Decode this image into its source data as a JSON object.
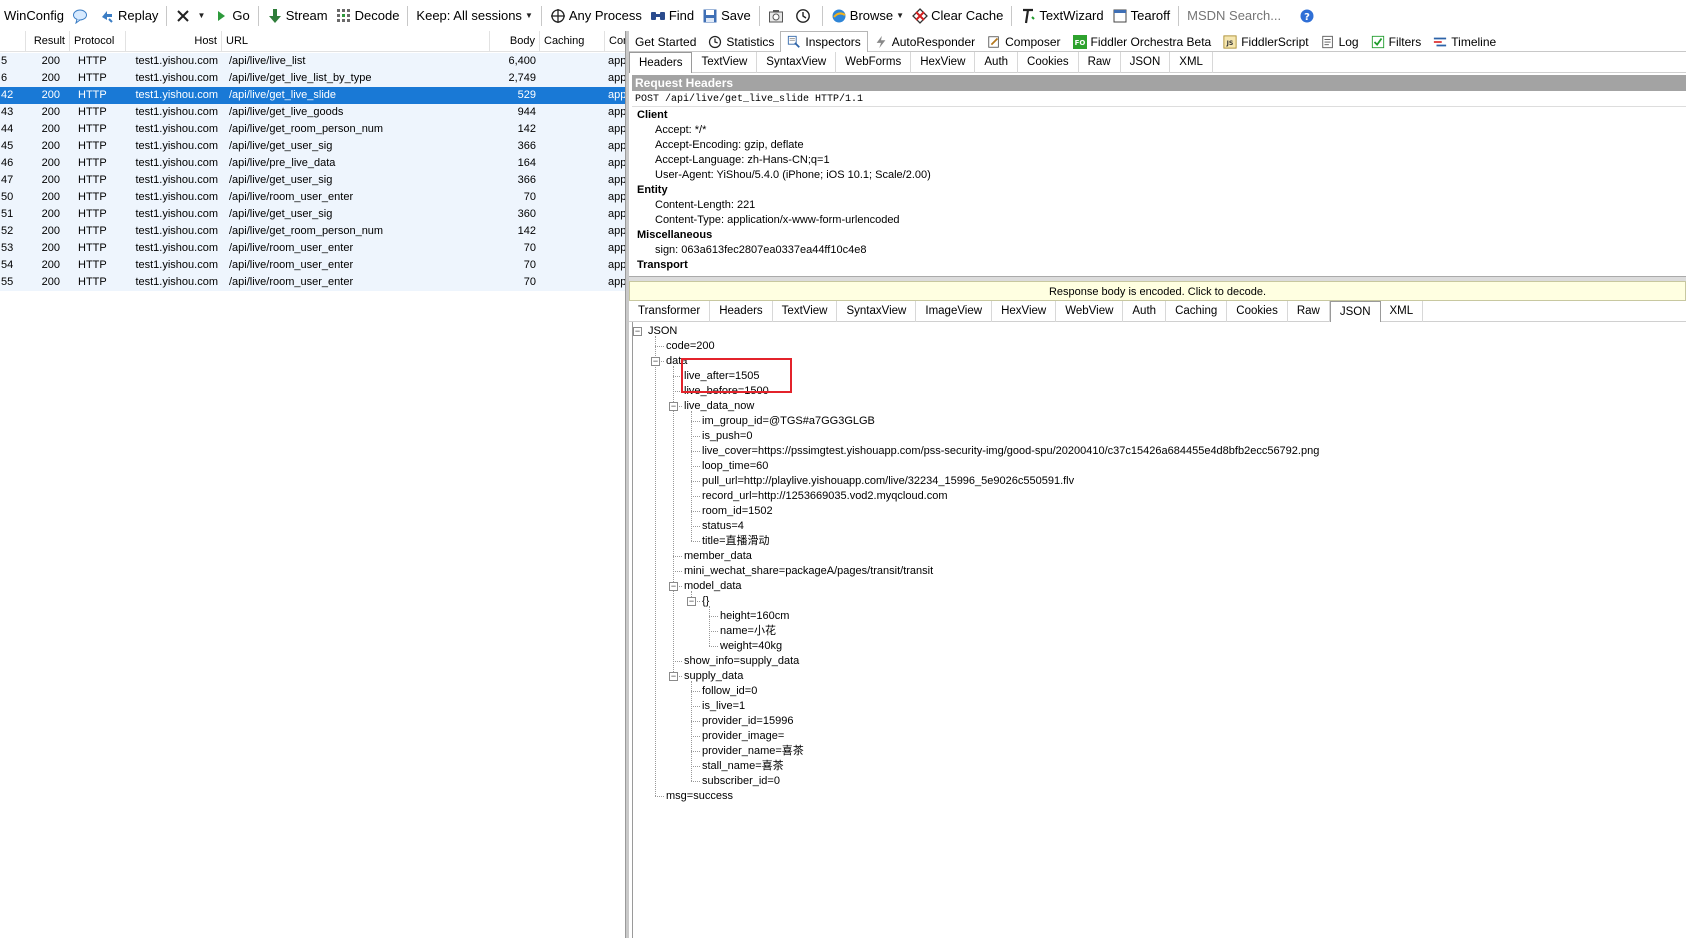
{
  "toolbar": {
    "items": [
      {
        "label": "WinConfig",
        "icon": "winconfig-icon"
      },
      {
        "label": "",
        "icon": "comment-icon"
      },
      {
        "label": "Replay",
        "icon": "replay-icon"
      },
      {
        "label": "",
        "icon": "remove-icon",
        "dropdown": true
      },
      {
        "label": "Go",
        "icon": "go-icon"
      },
      {
        "label": "Stream",
        "icon": "stream-icon"
      },
      {
        "label": "Decode",
        "icon": "decode-icon"
      },
      {
        "label": "Keep: All sessions",
        "icon": "",
        "dropdown": true
      },
      {
        "label": "Any Process",
        "icon": "crosshair-icon"
      },
      {
        "label": "Find",
        "icon": "find-icon"
      },
      {
        "label": "Save",
        "icon": "save-icon"
      },
      {
        "label": "",
        "icon": "camera-icon"
      },
      {
        "label": "",
        "icon": "timer-icon"
      },
      {
        "label": "Browse",
        "icon": "browse-icon",
        "dropdown": true
      },
      {
        "label": "Clear Cache",
        "icon": "clear-cache-icon"
      },
      {
        "label": "TextWizard",
        "icon": "textwizard-icon"
      },
      {
        "label": "Tearoff",
        "icon": "tearoff-icon"
      }
    ],
    "search_placeholder": "MSDN Search...",
    "help_icon": "help-icon"
  },
  "sessions": {
    "columns": [
      "Result",
      "Protocol",
      "Host",
      "URL",
      "Body",
      "Caching",
      "Cor"
    ],
    "rows": [
      {
        "num": "5",
        "result": "200",
        "protocol": "HTTP",
        "host": "test1.yishou.com",
        "url": "/api/live/live_list",
        "body": "6,400",
        "content": "app"
      },
      {
        "num": "6",
        "result": "200",
        "protocol": "HTTP",
        "host": "test1.yishou.com",
        "url": "/api/live/get_live_list_by_type",
        "body": "2,749",
        "content": "app"
      },
      {
        "num": "42",
        "result": "200",
        "protocol": "HTTP",
        "host": "test1.yishou.com",
        "url": "/api/live/get_live_slide",
        "body": "529",
        "content": "app",
        "selected": true
      },
      {
        "num": "43",
        "result": "200",
        "protocol": "HTTP",
        "host": "test1.yishou.com",
        "url": "/api/live/get_live_goods",
        "body": "944",
        "content": "app"
      },
      {
        "num": "44",
        "result": "200",
        "protocol": "HTTP",
        "host": "test1.yishou.com",
        "url": "/api/live/get_room_person_num",
        "body": "142",
        "content": "app"
      },
      {
        "num": "45",
        "result": "200",
        "protocol": "HTTP",
        "host": "test1.yishou.com",
        "url": "/api/live/get_user_sig",
        "body": "366",
        "content": "app"
      },
      {
        "num": "46",
        "result": "200",
        "protocol": "HTTP",
        "host": "test1.yishou.com",
        "url": "/api/live/pre_live_data",
        "body": "164",
        "content": "app"
      },
      {
        "num": "47",
        "result": "200",
        "protocol": "HTTP",
        "host": "test1.yishou.com",
        "url": "/api/live/get_user_sig",
        "body": "366",
        "content": "app"
      },
      {
        "num": "50",
        "result": "200",
        "protocol": "HTTP",
        "host": "test1.yishou.com",
        "url": "/api/live/room_user_enter",
        "body": "70",
        "content": "app"
      },
      {
        "num": "51",
        "result": "200",
        "protocol": "HTTP",
        "host": "test1.yishou.com",
        "url": "/api/live/get_user_sig",
        "body": "360",
        "content": "app"
      },
      {
        "num": "52",
        "result": "200",
        "protocol": "HTTP",
        "host": "test1.yishou.com",
        "url": "/api/live/get_room_person_num",
        "body": "142",
        "content": "app"
      },
      {
        "num": "53",
        "result": "200",
        "protocol": "HTTP",
        "host": "test1.yishou.com",
        "url": "/api/live/room_user_enter",
        "body": "70",
        "content": "app"
      },
      {
        "num": "54",
        "result": "200",
        "protocol": "HTTP",
        "host": "test1.yishou.com",
        "url": "/api/live/room_user_enter",
        "body": "70",
        "content": "app"
      },
      {
        "num": "55",
        "result": "200",
        "protocol": "HTTP",
        "host": "test1.yishou.com",
        "url": "/api/live/room_user_enter",
        "body": "70",
        "content": "app"
      }
    ]
  },
  "main_tabs": [
    {
      "label": "Get Started",
      "icon": ""
    },
    {
      "label": "Statistics",
      "icon": "statistics-icon"
    },
    {
      "label": "Inspectors",
      "icon": "inspectors-icon",
      "active": true
    },
    {
      "label": "AutoResponder",
      "icon": "autoresponder-icon"
    },
    {
      "label": "Composer",
      "icon": "composer-icon"
    },
    {
      "label": "Fiddler Orchestra Beta",
      "icon": "orchestra-icon",
      "badge": "FO"
    },
    {
      "label": "FiddlerScript",
      "icon": "fiddlerscript-icon",
      "badge": "JS"
    },
    {
      "label": "Log",
      "icon": "log-icon"
    },
    {
      "label": "Filters",
      "icon": "filters-icon"
    },
    {
      "label": "Timeline",
      "icon": "timeline-icon"
    }
  ],
  "request_tabs": [
    {
      "label": "Headers",
      "active": true
    },
    {
      "label": "TextView"
    },
    {
      "label": "SyntaxView"
    },
    {
      "label": "WebForms"
    },
    {
      "label": "HexView"
    },
    {
      "label": "Auth"
    },
    {
      "label": "Cookies"
    },
    {
      "label": "Raw"
    },
    {
      "label": "JSON"
    },
    {
      "label": "XML"
    }
  ],
  "request": {
    "title": "Request Headers",
    "request_line": "POST /api/live/get_live_slide HTTP/1.1",
    "groups": [
      {
        "name": "Client",
        "lines": [
          "Accept: */*",
          "Accept-Encoding: gzip, deflate",
          "Accept-Language: zh-Hans-CN;q=1",
          "User-Agent: YiShou/5.4.0 (iPhone; iOS 10.1; Scale/2.00)"
        ]
      },
      {
        "name": "Entity",
        "lines": [
          "Content-Length: 221",
          "Content-Type: application/x-www-form-urlencoded"
        ]
      },
      {
        "name": "Miscellaneous",
        "lines": [
          "sign: 063a613fec2807ea0337ea44ff10c4e8"
        ]
      },
      {
        "name": "Transport",
        "lines": []
      }
    ]
  },
  "encoded_notice": "Response body is encoded. Click to decode.",
  "response_tabs": [
    {
      "label": "Transformer"
    },
    {
      "label": "Headers"
    },
    {
      "label": "TextView"
    },
    {
      "label": "SyntaxView"
    },
    {
      "label": "ImageView"
    },
    {
      "label": "HexView"
    },
    {
      "label": "WebView"
    },
    {
      "label": "Auth"
    },
    {
      "label": "Caching"
    },
    {
      "label": "Cookies"
    },
    {
      "label": "Raw"
    },
    {
      "label": "JSON",
      "active": true
    },
    {
      "label": "XML"
    }
  ],
  "json_tree": [
    {
      "depth": 0,
      "text": "JSON",
      "expander": true
    },
    {
      "depth": 1,
      "text": "code=200"
    },
    {
      "depth": 1,
      "text": "data",
      "expander": true
    },
    {
      "depth": 2,
      "text": "live_after=1505"
    },
    {
      "depth": 2,
      "text": "live_before=1500"
    },
    {
      "depth": 2,
      "text": "live_data_now",
      "expander": true
    },
    {
      "depth": 3,
      "text": "im_group_id=@TGS#a7GG3GLGB"
    },
    {
      "depth": 3,
      "text": "is_push=0"
    },
    {
      "depth": 3,
      "text": "live_cover=https://pssimgtest.yishouapp.com/pss-security-img/good-spu/20200410/c37c15426a684455e4d8bfb2ecc56792.png"
    },
    {
      "depth": 3,
      "text": "loop_time=60"
    },
    {
      "depth": 3,
      "text": "pull_url=http://playlive.yishouapp.com/live/32234_15996_5e9026c550591.flv"
    },
    {
      "depth": 3,
      "text": "record_url=http://1253669035.vod2.myqcloud.com"
    },
    {
      "depth": 3,
      "text": "room_id=1502"
    },
    {
      "depth": 3,
      "text": "status=4"
    },
    {
      "depth": 3,
      "text": "title=直播滑动"
    },
    {
      "depth": 2,
      "text": "member_data"
    },
    {
      "depth": 2,
      "text": "mini_wechat_share=packageA/pages/transit/transit"
    },
    {
      "depth": 2,
      "text": "model_data",
      "expander": true
    },
    {
      "depth": 3,
      "text": "{}",
      "expander": true
    },
    {
      "depth": 4,
      "text": "height=160cm"
    },
    {
      "depth": 4,
      "text": "name=小花"
    },
    {
      "depth": 4,
      "text": "weight=40kg"
    },
    {
      "depth": 2,
      "text": "show_info=supply_data"
    },
    {
      "depth": 2,
      "text": "supply_data",
      "expander": true
    },
    {
      "depth": 3,
      "text": "follow_id=0"
    },
    {
      "depth": 3,
      "text": "is_live=1"
    },
    {
      "depth": 3,
      "text": "provider_id=15996"
    },
    {
      "depth": 3,
      "text": "provider_image="
    },
    {
      "depth": 3,
      "text": "provider_name=喜茶"
    },
    {
      "depth": 3,
      "text": "stall_name=喜茶"
    },
    {
      "depth": 3,
      "text": "subscriber_id=0"
    },
    {
      "depth": 1,
      "text": "msg=success"
    }
  ],
  "colors": {
    "selection": "#1979d6",
    "row_bg": "#eef5fd",
    "highlight_box": "#e3232b",
    "header_bar": "#a3a3a3",
    "notice_bg": "#ffffe1"
  }
}
